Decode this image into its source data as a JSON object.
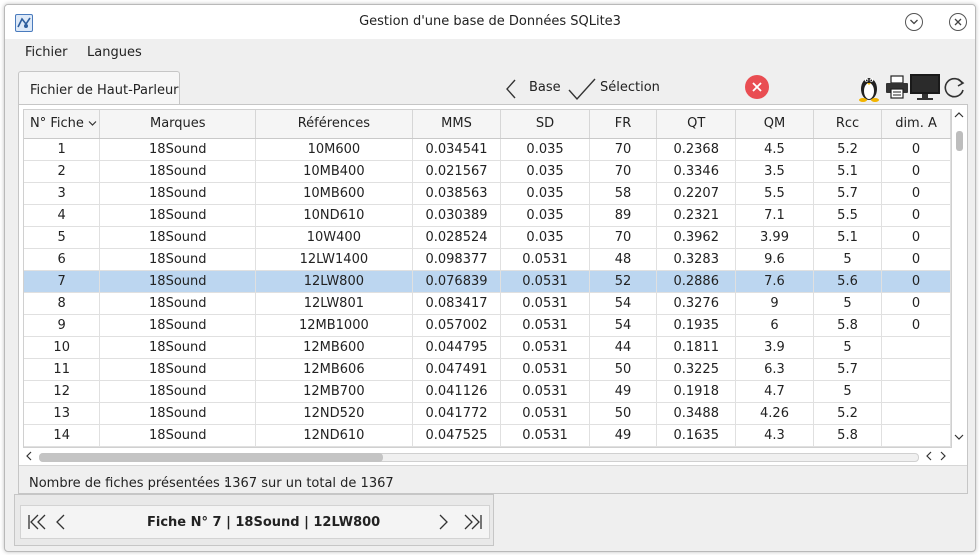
{
  "window": {
    "title": "Gestion d'une base de Données SQLite3"
  },
  "menu": {
    "fichier": "Fichier",
    "langues": "Langues"
  },
  "tab": {
    "label": "Fichier de Haut-Parleur"
  },
  "toolbar": {
    "base_label": "Base",
    "selection_label": "Sélection",
    "close_color": "#e94d52"
  },
  "table": {
    "columns": [
      "N° Fiche",
      "Marques",
      "Références",
      "MMS",
      "SD",
      "FR",
      "QT",
      "QM",
      "Rcc",
      "dim. A"
    ],
    "selected_row_index": 6,
    "selected_color": "#bcd6f0",
    "rows": [
      [
        "1",
        "18Sound",
        "10M600",
        "0.034541",
        "0.035",
        "70",
        "0.2368",
        "4.5",
        "5.2",
        "0"
      ],
      [
        "2",
        "18Sound",
        "10MB400",
        "0.021567",
        "0.035",
        "70",
        "0.3346",
        "3.5",
        "5.1",
        "0"
      ],
      [
        "3",
        "18Sound",
        "10MB600",
        "0.038563",
        "0.035",
        "58",
        "0.2207",
        "5.5",
        "5.7",
        "0"
      ],
      [
        "4",
        "18Sound",
        "10ND610",
        "0.030389",
        "0.035",
        "89",
        "0.2321",
        "7.1",
        "5.5",
        "0"
      ],
      [
        "5",
        "18Sound",
        "10W400",
        "0.028524",
        "0.035",
        "70",
        "0.3962",
        "3.99",
        "5.1",
        "0"
      ],
      [
        "6",
        "18Sound",
        "12LW1400",
        "0.098377",
        "0.0531",
        "48",
        "0.3283",
        "9.6",
        "5",
        "0"
      ],
      [
        "7",
        "18Sound",
        "12LW800",
        "0.076839",
        "0.0531",
        "52",
        "0.2886",
        "7.6",
        "5.6",
        "0"
      ],
      [
        "8",
        "18Sound",
        "12LW801",
        "0.083417",
        "0.0531",
        "54",
        "0.3276",
        "9",
        "5",
        "0"
      ],
      [
        "9",
        "18Sound",
        "12MB1000",
        "0.057002",
        "0.0531",
        "54",
        "0.1935",
        "6",
        "5.8",
        "0"
      ],
      [
        "10",
        "18Sound",
        "12MB600",
        "0.044795",
        "0.0531",
        "44",
        "0.1811",
        "3.9",
        "5",
        ""
      ],
      [
        "11",
        "18Sound",
        "12MB606",
        "0.047491",
        "0.0531",
        "50",
        "0.3225",
        "6.3",
        "5.7",
        ""
      ],
      [
        "12",
        "18Sound",
        "12MB700",
        "0.041126",
        "0.0531",
        "49",
        "0.1918",
        "4.7",
        "5",
        ""
      ],
      [
        "13",
        "18Sound",
        "12ND520",
        "0.041772",
        "0.0531",
        "50",
        "0.3488",
        "4.26",
        "5.2",
        ""
      ],
      [
        "14",
        "18Sound",
        "12ND610",
        "0.047525",
        "0.0531",
        "49",
        "0.1635",
        "4.3",
        "5.8",
        ""
      ]
    ]
  },
  "status": {
    "label": "Nombre de fiches présentées :",
    "value": "1367 sur un total de 1367"
  },
  "footer": {
    "record_label": "Fiche N° 7 | 18Sound | 12LW800"
  },
  "icons": {
    "app": "database-app-icon",
    "minimize": "chevron-down-icon",
    "close": "close-icon",
    "linux": "linux-tux-icon",
    "printer": "printer-icon",
    "monitor": "monitor-icon",
    "refresh": "refresh-icon"
  }
}
